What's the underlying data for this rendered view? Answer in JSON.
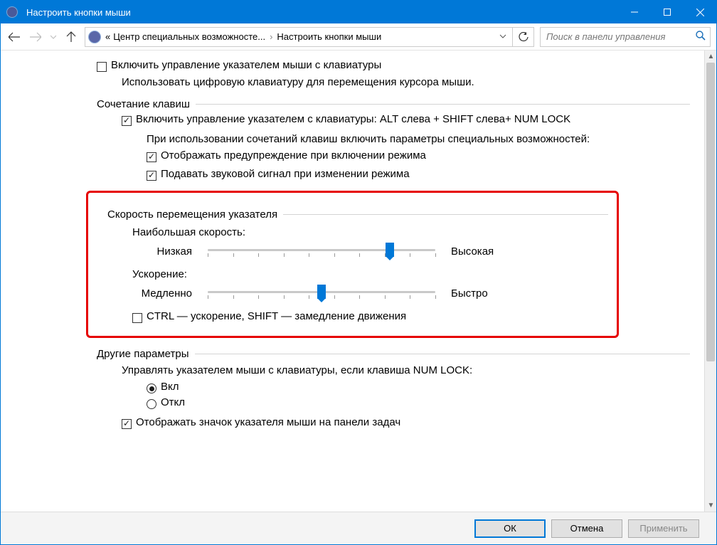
{
  "window": {
    "title": "Настроить кнопки мыши"
  },
  "breadcrumb": {
    "prefix": "«",
    "part1": "Центр специальных возможносте...",
    "part2": "Настроить кнопки мыши"
  },
  "search": {
    "placeholder": "Поиск в панели управления"
  },
  "main": {
    "enable_mouse_keys": "Включить управление указателем мыши с клавиатуры",
    "enable_mouse_keys_desc": "Использовать цифровую клавиатуру для перемещения курсора мыши.",
    "hotkeys_group": "Сочетание клавиш",
    "hotkey_enable": "Включить управление указателем с клавиатуры: ALT слева + SHIFT слева+ NUM LOCK",
    "hotkey_desc": "При использовании сочетаний клавиш включить параметры специальных возможностей:",
    "show_warning": "Отображать предупреждение при включении режима",
    "play_sound": "Подавать звуковой сигнал при изменении режима",
    "speed_group": "Скорость перемещения указателя",
    "top_speed_label": "Наибольшая скорость:",
    "top_speed_low": "Низкая",
    "top_speed_high": "Высокая",
    "accel_label": "Ускорение:",
    "accel_slow": "Медленно",
    "accel_fast": "Быстро",
    "ctrl_shift": "CTRL — ускорение, SHIFT — замедление движения",
    "other_group": "Другие параметры",
    "numlock_label": "Управлять указателем мыши с клавиатуры, если клавиша NUM LOCK:",
    "numlock_on": "Вкл",
    "numlock_off": "Откл",
    "tray_icon": "Отображать значок указателя мыши на панели задач"
  },
  "sliders": {
    "top_speed_pct": 80,
    "accel_pct": 50
  },
  "footer": {
    "ok": "ОК",
    "cancel": "Отмена",
    "apply": "Применить"
  }
}
